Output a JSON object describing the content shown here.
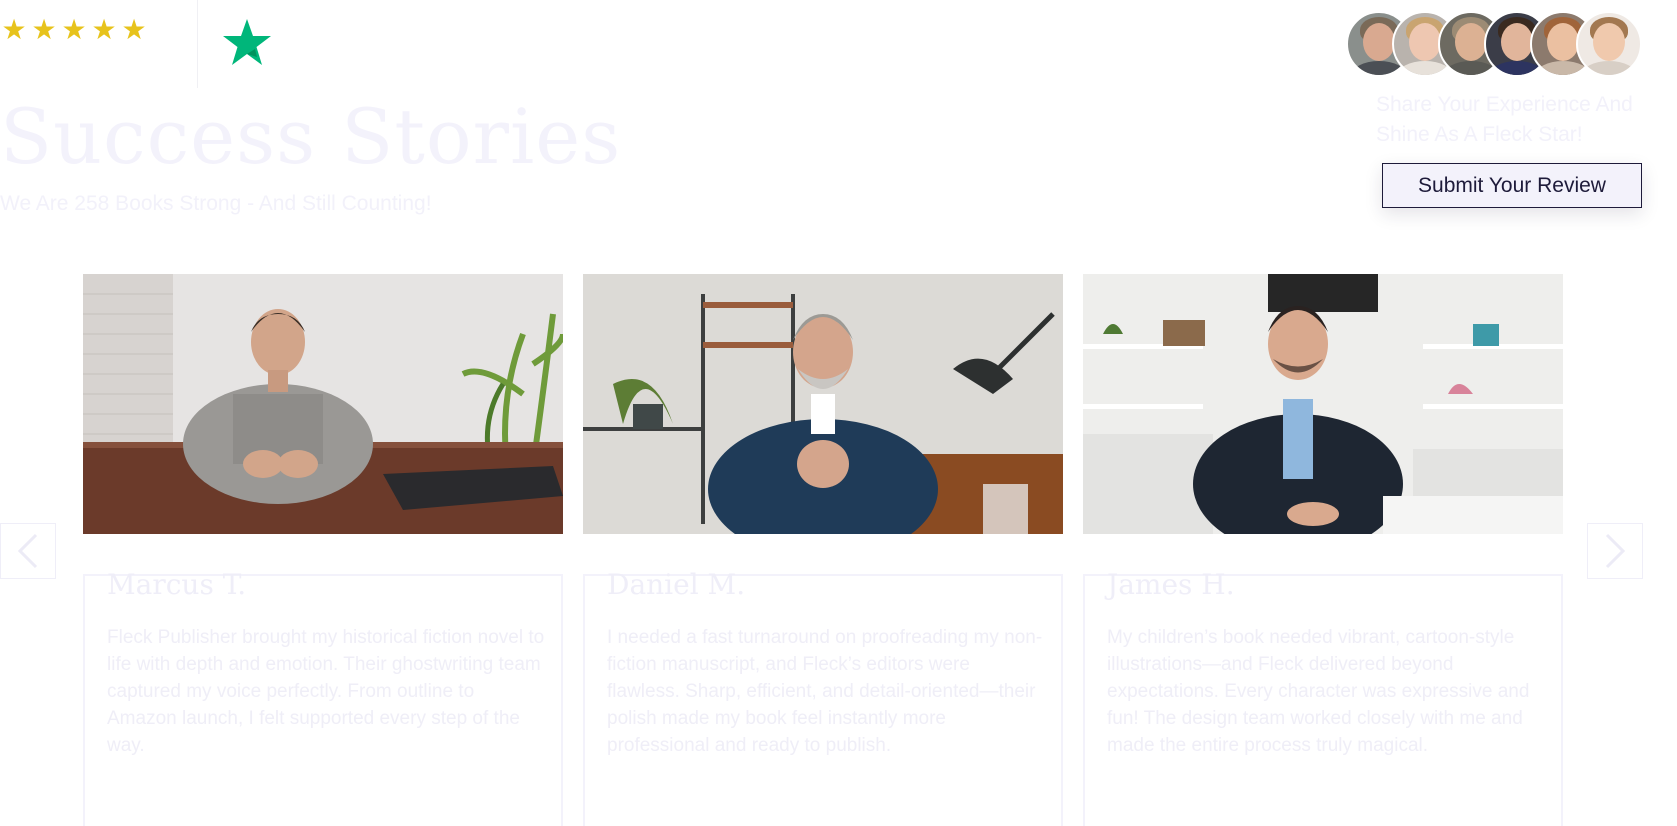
{
  "header": {
    "rating_stars": [
      "★",
      "★",
      "★",
      "★",
      "★"
    ],
    "rating_star_color": "#e7c31c",
    "platform_icon": "trustpilot-star-icon",
    "platform_color": "#00b67a",
    "title": "Success  Stories",
    "subtitle": "We Are 258 Books Strong - And Still Counting!"
  },
  "review_cta": {
    "prompt": "Share Your Experience And Shine As A Fleck Star!",
    "button_label": "Submit Your Review",
    "reviewer_avatars": [
      "avatar-1",
      "avatar-2",
      "avatar-3",
      "avatar-4",
      "avatar-5",
      "avatar-6"
    ]
  },
  "carousel": {
    "prev_icon": "chevron-left-icon",
    "next_icon": "chevron-right-icon",
    "testimonials": [
      {
        "name": "Marcus  T.",
        "text": "Fleck Publisher brought my historical fiction novel to life with depth and emotion. Their ghostwriting team captured my voice perfectly. From outline to Amazon launch, I felt supported every step of the way."
      },
      {
        "name": "Daniel  M.",
        "text": "I needed a fast turnaround on proofreading my non-fiction manuscript, and Fleck’s editors were flawless. Sharp, efficient, and detail-oriented—their polish made my book feel instantly more professional and ready to publish."
      },
      {
        "name": "James  H.",
        "text": "My children’s book needed vibrant, cartoon-style illustrations—and Fleck delivered beyond expectations. Every character was expressive and fun! The design team worked closely with me and made the entire process truly magical."
      }
    ]
  },
  "colors": {
    "accent_dark": "#1e1b3a",
    "faded_lavender": "#f3f2fb"
  }
}
